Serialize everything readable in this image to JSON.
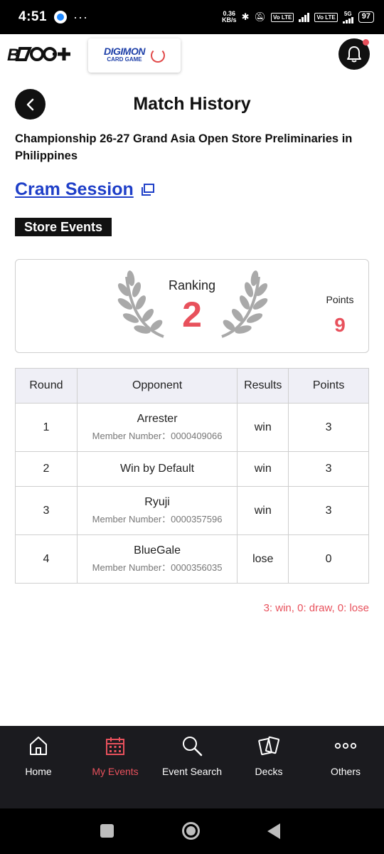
{
  "status_bar": {
    "time": "4:51",
    "dots": "···",
    "speed_value": "0.36",
    "speed_unit": "KB/s",
    "volte1": "Vo LTE",
    "volte2": "Vo LTE",
    "net": "5G",
    "battery": "97"
  },
  "header": {
    "brand_logo": "B TCG+",
    "game_logo_main": "DIGIMON",
    "game_logo_sub": "CARD GAME",
    "bell_icon": "bell-icon"
  },
  "page": {
    "title": "Match History",
    "event_name": "Championship 26-27 Grand Asia Open Store Preliminaries in Philippines",
    "store_name": "Cram Session",
    "badge": "Store Events"
  },
  "ranking": {
    "label": "Ranking",
    "value": "2",
    "points_label": "Points",
    "points_value": "9"
  },
  "table": {
    "headers": {
      "round": "Round",
      "opponent": "Opponent",
      "results": "Results",
      "points": "Points"
    },
    "rows": [
      {
        "round": "1",
        "opponent": "Arrester",
        "member": "Member Number：0000409066",
        "result": "win",
        "points": "3"
      },
      {
        "round": "2",
        "opponent": "Win by Default",
        "member": "",
        "result": "win",
        "points": "3"
      },
      {
        "round": "3",
        "opponent": "Ryuji",
        "member": "Member Number：0000357596",
        "result": "win",
        "points": "3"
      },
      {
        "round": "4",
        "opponent": "BlueGale",
        "member": "Member Number：0000356035",
        "result": "lose",
        "points": "0"
      }
    ]
  },
  "summary": "3: win, 0: draw, 0: lose",
  "nav": {
    "items": [
      {
        "label": "Home",
        "icon": "home-icon"
      },
      {
        "label": "My Events",
        "icon": "calendar-icon"
      },
      {
        "label": "Event Search",
        "icon": "search-icon"
      },
      {
        "label": "Decks",
        "icon": "cards-icon"
      },
      {
        "label": "Others",
        "icon": "more-icon"
      }
    ],
    "active_index": 1
  },
  "colors": {
    "accent": "#e8515c",
    "link": "#1f3fc8",
    "nav_bg": "#1b1b1f"
  }
}
